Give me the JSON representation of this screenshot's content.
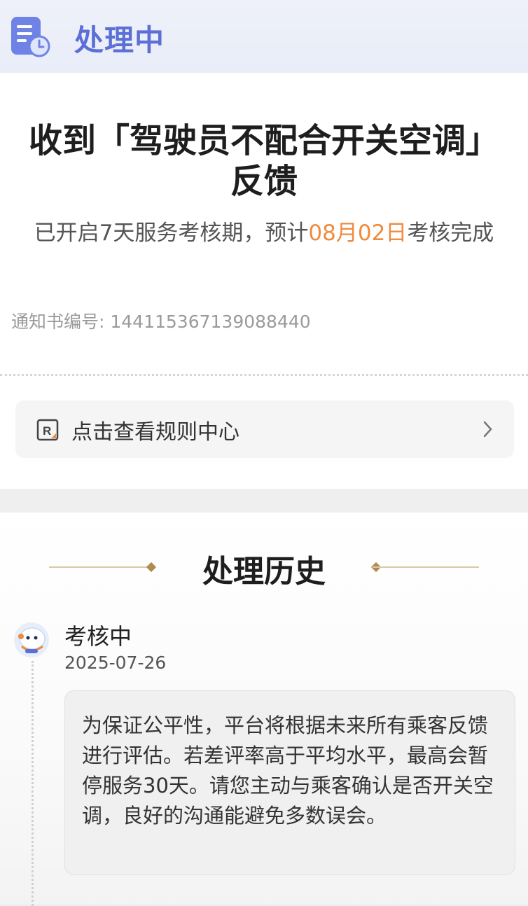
{
  "status": {
    "title": "处理中",
    "icon": "document-clock-icon",
    "color": "#5b6fd6"
  },
  "notice": {
    "headline": "收到「驾驶员不配合开关空调」反馈",
    "sub_prefix": "已开启7天服务考核期，预计",
    "sub_date": "08月02日",
    "sub_suffix": "考核完成",
    "highlight_color": "#f08a3c",
    "number_label": "通知书编号: 1441153671390884​40"
  },
  "rule_link": {
    "label": "点击查看规则中心",
    "icon": "rule-book-icon",
    "chevron": "chevron-right-icon"
  },
  "history": {
    "title": "处理历史",
    "entries": [
      {
        "status": "考核中",
        "date": "2025-07-26",
        "message": "为保证公平性，平台将根据未来所有乘客反馈进行评估。若差评率高于平均水平，最高会暂停服务30天。请您主动与乘客确认是否开关空调，良好的沟通能避免多数误会。",
        "avatar": "robot-agent-avatar"
      }
    ]
  }
}
